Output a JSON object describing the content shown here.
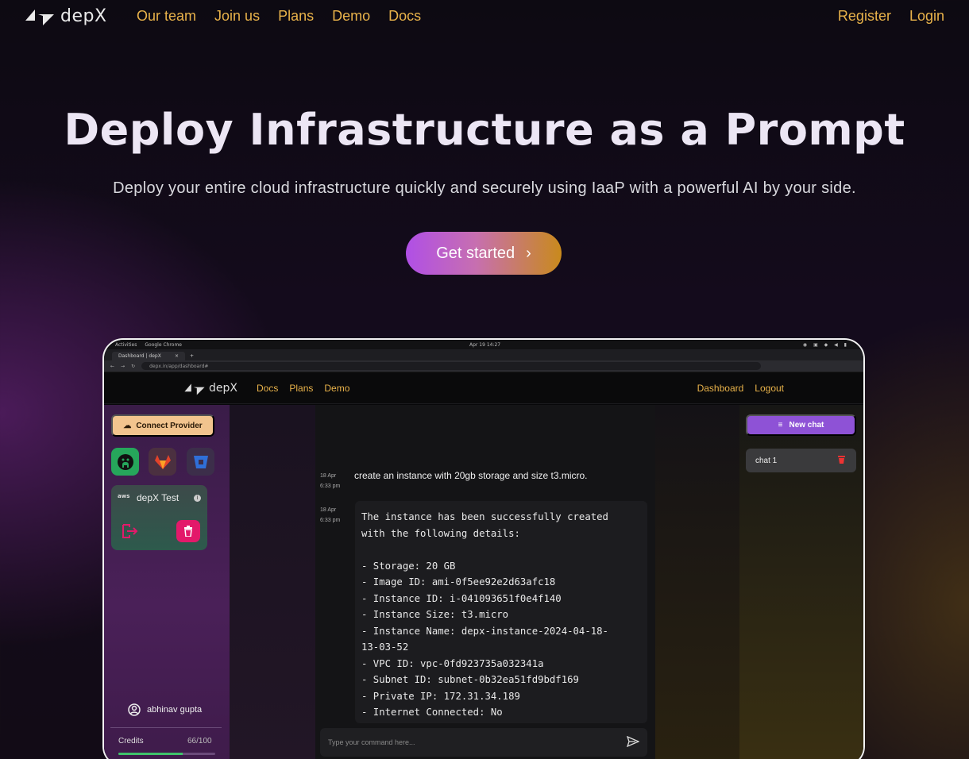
{
  "nav": {
    "logo": "depX",
    "links": [
      "Our team",
      "Join us",
      "Plans",
      "Demo",
      "Docs"
    ],
    "register": "Register",
    "login": "Login"
  },
  "hero": {
    "title": "Deploy Infrastructure as a Prompt",
    "subtitle": "Deploy your entire cloud infrastructure quickly and securely using IaaP with a powerful AI by your side.",
    "cta": "Get started"
  },
  "screenshot": {
    "os": {
      "activities": "Activities",
      "app": "Google Chrome",
      "clock": "Apr 19 14:27"
    },
    "browser": {
      "tab_title": "Dashboard | depX",
      "url": "depx.in/app/dashboard#"
    },
    "app_nav": {
      "logo": "depX",
      "links": [
        "Docs",
        "Plans",
        "Demo"
      ],
      "dashboard": "Dashboard",
      "logout": "Logout"
    },
    "sidebar": {
      "connect_label": "Connect Provider",
      "providers": [
        "github",
        "gitlab",
        "bitbucket"
      ],
      "account": {
        "provider": "aws",
        "name": "depX Test"
      },
      "user": "abhinav gupta",
      "credits_label": "Credits",
      "credits_value": "66/100",
      "credits_fraction": 0.66
    },
    "chat": {
      "messages": [
        {
          "date": "18 Apr",
          "time": "6:33 pm",
          "text": "create an instance with 20gb storage and size t3.micro."
        },
        {
          "date": "18 Apr",
          "time": "6:33 pm",
          "text": "The instance has been successfully created\nwith the following details:\n\n- Storage: 20 GB\n- Image ID: ami-0f5ee92e2d63afc18\n- Instance ID: i-041093651f0e4f140\n- Instance Size: t3.micro\n- Instance Name: depx-instance-2024-04-18-\n13-03-52\n- VPC ID: vpc-0fd923735a032341a\n- Subnet ID: subnet-0b32ea51fd9bdf169\n- Private IP: 172.31.34.189\n- Internet Connected: No"
        }
      ],
      "input_placeholder": "Type your command here..."
    },
    "rightbar": {
      "new_chat": "New chat",
      "chats": [
        "chat 1"
      ]
    }
  },
  "colors": {
    "accent": "#e8b24a",
    "purple": "#8e52d6",
    "danger": "#e3196a",
    "success": "#3fc26b"
  }
}
